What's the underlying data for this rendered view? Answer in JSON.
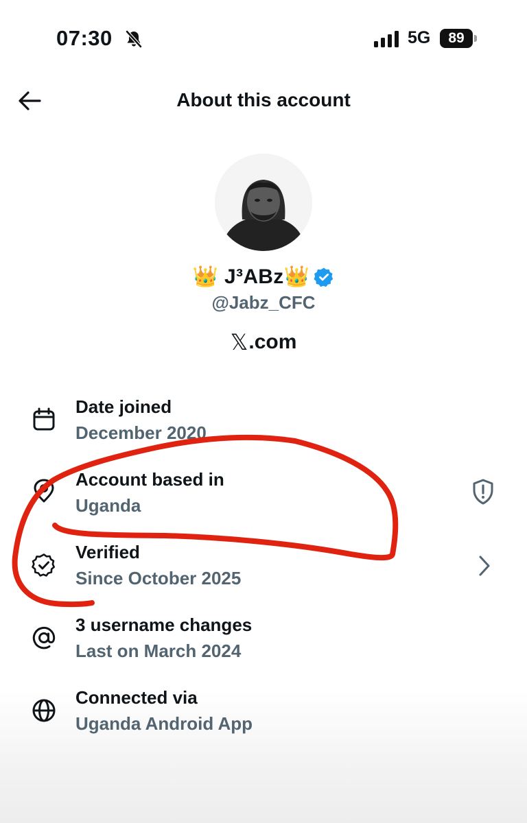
{
  "status_bar": {
    "time": "07:30",
    "network": "5G",
    "battery": "89",
    "icons": [
      "bell-slash-icon",
      "signal-bars-icon",
      "battery-icon"
    ]
  },
  "header": {
    "title": "About this account",
    "back_icon": "arrow-left-icon"
  },
  "profile": {
    "display_name": "👑 J³ABz👑",
    "handle": "@Jabz_CFC",
    "verified_badge_color": "#1d9bf0",
    "site_x": "𝕏",
    "site_rest": ".com"
  },
  "rows": [
    {
      "icon": "calendar-icon",
      "label": "Date joined",
      "value": "December 2020"
    },
    {
      "icon": "location-pin-icon",
      "label": "Account based in",
      "value": "Uganda",
      "right_icon": "shield-alert-icon"
    },
    {
      "icon": "verified-check-icon",
      "label": "Verified",
      "value": "Since October 2025",
      "right_icon": "chevron-right-icon"
    },
    {
      "icon": "at-sign-icon",
      "label": "3 username changes",
      "value": "Last on March 2024"
    },
    {
      "icon": "globe-icon",
      "label": "Connected via",
      "value": "Uganda Android App"
    }
  ],
  "colors": {
    "text_primary": "#0f1419",
    "text_secondary": "#536471",
    "annotation_red": "#e02310"
  }
}
